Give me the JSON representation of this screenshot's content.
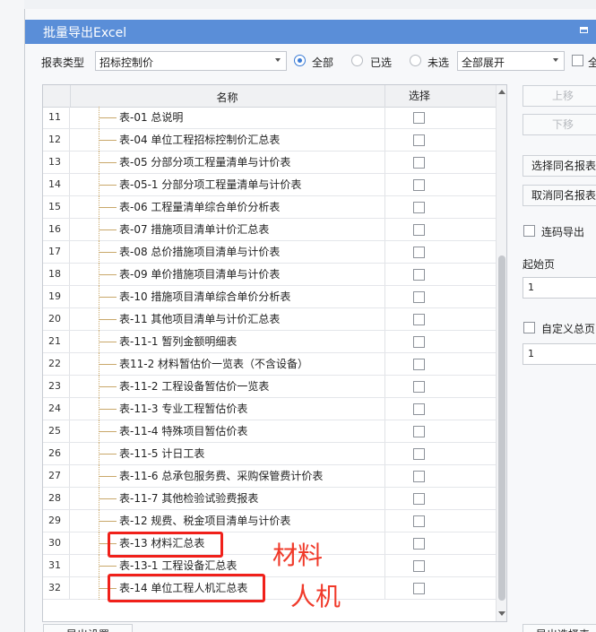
{
  "window": {
    "title": "批量导出Excel"
  },
  "toolbar": {
    "report_type_label": "报表类型",
    "report_type_value": "招标控制价",
    "radio_all": "全部",
    "radio_selected": "已选",
    "radio_unselected": "未选",
    "expand_value": "全部展开",
    "select_all_label": "全"
  },
  "table": {
    "col_name": "名称",
    "col_select": "选择",
    "rows": [
      {
        "idx": "11",
        "name": "表-01 总说明"
      },
      {
        "idx": "12",
        "name": "表-04 单位工程招标控制价汇总表"
      },
      {
        "idx": "13",
        "name": "表-05 分部分项工程量清单与计价表"
      },
      {
        "idx": "14",
        "name": "表-05-1 分部分项工程量清单与计价表"
      },
      {
        "idx": "15",
        "name": "表-06 工程量清单综合单价分析表"
      },
      {
        "idx": "16",
        "name": "表-07 措施项目清单计价汇总表"
      },
      {
        "idx": "17",
        "name": "表-08 总价措施项目清单与计价表"
      },
      {
        "idx": "18",
        "name": "表-09 单价措施项目清单与计价表"
      },
      {
        "idx": "19",
        "name": "表-10 措施项目清单综合单价分析表"
      },
      {
        "idx": "20",
        "name": "表-11 其他项目清单与计价汇总表"
      },
      {
        "idx": "21",
        "name": "表-11-1 暂列金额明细表"
      },
      {
        "idx": "22",
        "name": "表11-2 材料暂估价一览表（不含设备）"
      },
      {
        "idx": "23",
        "name": "表-11-2 工程设备暂估价一览表"
      },
      {
        "idx": "24",
        "name": "表-11-3 专业工程暂估价表"
      },
      {
        "idx": "25",
        "name": "表-11-4 特殊项目暂估价表"
      },
      {
        "idx": "26",
        "name": "表-11-5 计日工表"
      },
      {
        "idx": "27",
        "name": "表-11-6 总承包服务费、采购保管费计价表"
      },
      {
        "idx": "28",
        "name": "表-11-7 其他检验试验费报表"
      },
      {
        "idx": "29",
        "name": "表-12 规费、税金项目清单与计价表"
      },
      {
        "idx": "30",
        "name": "表-13 材料汇总表"
      },
      {
        "idx": "31",
        "name": "表-13-1 工程设备汇总表"
      },
      {
        "idx": "32",
        "name": "表-14 单位工程人机汇总表"
      }
    ]
  },
  "annotations": {
    "material": "材料",
    "labor_machine": "人机"
  },
  "right_panel": {
    "move_up": "上移",
    "move_down": "下移",
    "select_same": "选择同名报表",
    "cancel_same": "取消同名报表",
    "continuous_export": "连码导出",
    "start_page_label": "起始页",
    "start_page_value": "1",
    "custom_total_label": "自定义总页",
    "custom_total_value": "1"
  },
  "bottom": {
    "export_settings": "导出设置",
    "export_selected": "导出选择表"
  }
}
